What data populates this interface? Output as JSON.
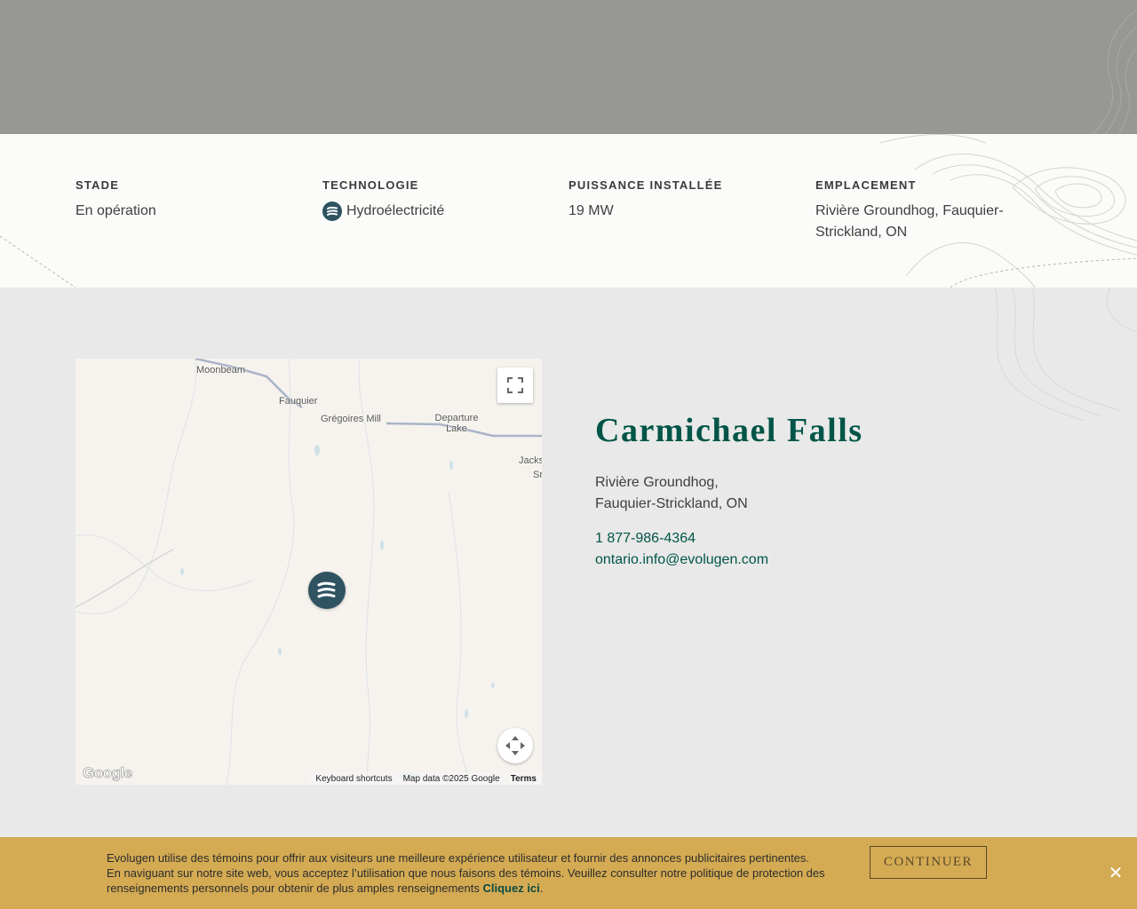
{
  "facts": [
    {
      "label": "STADE",
      "value": "En opération"
    },
    {
      "label": "TECHNOLOGIE",
      "value": "Hydroélectricité",
      "icon": "hydro-wave-icon"
    },
    {
      "label": "PUISSANCE INSTALLÉE",
      "value": "19 MW"
    },
    {
      "label": "EMPLACEMENT",
      "value": "Rivière Groundhog, Fauquier-Strickland, ON"
    }
  ],
  "map": {
    "places": [
      "Moonbeam",
      "Fauquier",
      "Grégoires Mill",
      "Departure Lake",
      "Jacks",
      "Sr"
    ],
    "logo": "Google",
    "keyboard_shortcuts": "Keyboard shortcuts",
    "map_data": "Map data ©2025 Google",
    "terms": "Terms",
    "marker_icon": "hydro-wave-icon"
  },
  "facility": {
    "title": "Carmichael Falls",
    "address_line1": "Rivière Groundhog,",
    "address_line2": "Fauquier-Strickland, ON",
    "phone": "1 877-986-4364",
    "email": "ontario.info@evolugen.com"
  },
  "cookie": {
    "message": "Evolugen utilise des témoins pour offrir aux visiteurs une meilleure expérience utilisateur et fournir des annonces publicitaires pertinentes. En naviguant sur notre site web, vous acceptez l’utilisation que nous faisons des témoins. Veuillez consulter notre politique de protection des renseignements personnels pour obtenir de plus amples renseignements",
    "link_label": "Cliquez ici",
    "continue_label": "CONTINUER",
    "close_glyph": "✕"
  },
  "colors": {
    "brand_green": "#005548",
    "marker": "#2f5360",
    "cookie_bg": "#d4ab53",
    "hero_gray": "#979795"
  }
}
